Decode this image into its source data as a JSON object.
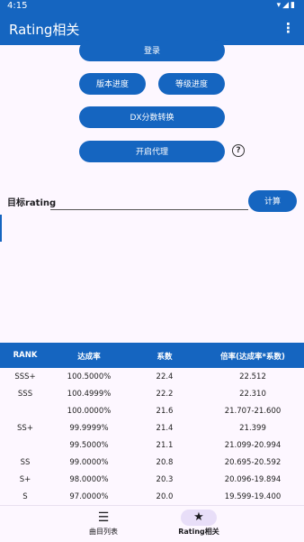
{
  "status_bar": {
    "time": "4:15",
    "icons": "▾◢▮"
  },
  "app_bar": {
    "title": "Rating相关",
    "menu_icon": "⋮"
  },
  "buttons": {
    "login": "登录",
    "version_progress": "版本进度",
    "level_progress": "等级进度",
    "dx_convert": "DX分数转换",
    "proxy": "开启代理",
    "help": "?"
  },
  "target": {
    "label": "目标rating",
    "value": "",
    "calc_label": "计算"
  },
  "table": {
    "headers": [
      "RANK",
      "达成率",
      "系数",
      "倍率(达成率*系数)"
    ],
    "rows": [
      [
        "SSS+",
        "100.5000%",
        "22.4",
        "22.512"
      ],
      [
        "SSS",
        "100.4999%",
        "22.2",
        "22.310"
      ],
      [
        "",
        "100.0000%",
        "21.6",
        "21.707-21.600"
      ],
      [
        "SS+",
        "99.9999%",
        "21.4",
        "21.399"
      ],
      [
        "",
        "99.5000%",
        "21.1",
        "21.099-20.994"
      ],
      [
        "SS",
        "99.0000%",
        "20.8",
        "20.695-20.592"
      ],
      [
        "S+",
        "98.0000%",
        "20.3",
        "20.096-19.894"
      ],
      [
        "S",
        "97.0000%",
        "20.0",
        "19.599-19.400"
      ]
    ]
  },
  "bottom_nav": {
    "songs": {
      "label": "曲目列表",
      "icon": "list-icon"
    },
    "rating": {
      "label": "Rating相关",
      "icon": "star-icon"
    }
  }
}
